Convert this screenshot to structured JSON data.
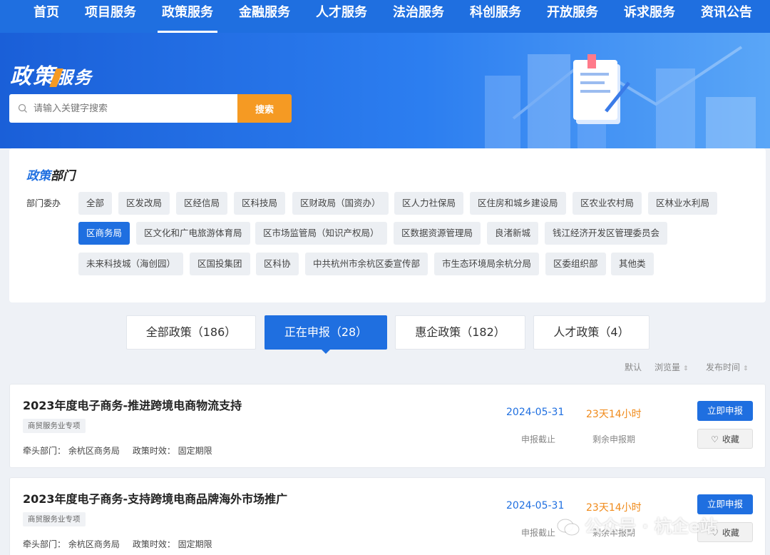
{
  "nav": {
    "items": [
      {
        "label": "首页",
        "active": false
      },
      {
        "label": "项目服务",
        "active": false
      },
      {
        "label": "政策服务",
        "active": true
      },
      {
        "label": "金融服务",
        "active": false
      },
      {
        "label": "人才服务",
        "active": false
      },
      {
        "label": "法治服务",
        "active": false
      },
      {
        "label": "科创服务",
        "active": false
      },
      {
        "label": "开放服务",
        "active": false
      },
      {
        "label": "诉求服务",
        "active": false
      },
      {
        "label": "资讯公告",
        "active": false
      }
    ]
  },
  "banner": {
    "title_part1": "政策",
    "title_part2": "服务"
  },
  "search": {
    "placeholder": "请输入关键字搜索",
    "button_label": "搜索"
  },
  "departments": {
    "title_part1": "政策",
    "title_part2": "部门",
    "category_label": "部门委办",
    "tags": [
      {
        "label": "全部",
        "active": false
      },
      {
        "label": "区发改局",
        "active": false
      },
      {
        "label": "区经信局",
        "active": false
      },
      {
        "label": "区科技局",
        "active": false
      },
      {
        "label": "区财政局（国资办）",
        "active": false
      },
      {
        "label": "区人力社保局",
        "active": false
      },
      {
        "label": "区住房和城乡建设局",
        "active": false
      },
      {
        "label": "区农业农村局",
        "active": false
      },
      {
        "label": "区林业水利局",
        "active": false
      },
      {
        "label": "区商务局",
        "active": true
      },
      {
        "label": "区文化和广电旅游体育局",
        "active": false
      },
      {
        "label": "区市场监管局（知识产权局）",
        "active": false
      },
      {
        "label": "区数据资源管理局",
        "active": false
      },
      {
        "label": "良渚新城",
        "active": false
      },
      {
        "label": "钱江经济开发区管理委员会",
        "active": false
      },
      {
        "label": "未来科技城（海创园）",
        "active": false
      },
      {
        "label": "区国投集团",
        "active": false
      },
      {
        "label": "区科协",
        "active": false
      },
      {
        "label": "中共杭州市余杭区委宣传部",
        "active": false
      },
      {
        "label": "市生态环境局余杭分局",
        "active": false
      },
      {
        "label": "区委组织部",
        "active": false
      },
      {
        "label": "其他类",
        "active": false
      }
    ]
  },
  "tabs": [
    {
      "label": "全部政策（186）",
      "active": false
    },
    {
      "label": "正在申报（28）",
      "active": true
    },
    {
      "label": "惠企政策（182）",
      "active": false
    },
    {
      "label": "人才政策（4）",
      "active": false
    }
  ],
  "sort": {
    "default": "默认",
    "views": "浏览量",
    "publish_time": "发布时间"
  },
  "policies": [
    {
      "title": "2023年度电子商务-推进跨境电商物流支持",
      "tag": "商贸服务业专项",
      "lead_dept": "牵头部门：  余杭区商务局",
      "validity": "政策时效：  固定期限",
      "deadline": "2024-05-31",
      "deadline_label": "申报截止",
      "remaining": "23天14小时",
      "remaining_label": "剩余申报期",
      "apply_label": "立即申报",
      "fav_label": "收藏"
    },
    {
      "title": "2023年度电子商务-支持跨境电商品牌海外市场推广",
      "tag": "商贸服务业专项",
      "lead_dept": "牵头部门：  余杭区商务局",
      "validity": "政策时效：  固定期限",
      "deadline": "2024-05-31",
      "deadline_label": "申报截止",
      "remaining": "23天14小时",
      "remaining_label": "剩余申报期",
      "apply_label": "立即申报",
      "fav_label": "收藏"
    }
  ],
  "watermark": {
    "text": "公众号 · 杭企e站"
  },
  "colors": {
    "primary": "#1f6fe0",
    "accent": "#f59a23",
    "countdown": "#f08a1a"
  }
}
